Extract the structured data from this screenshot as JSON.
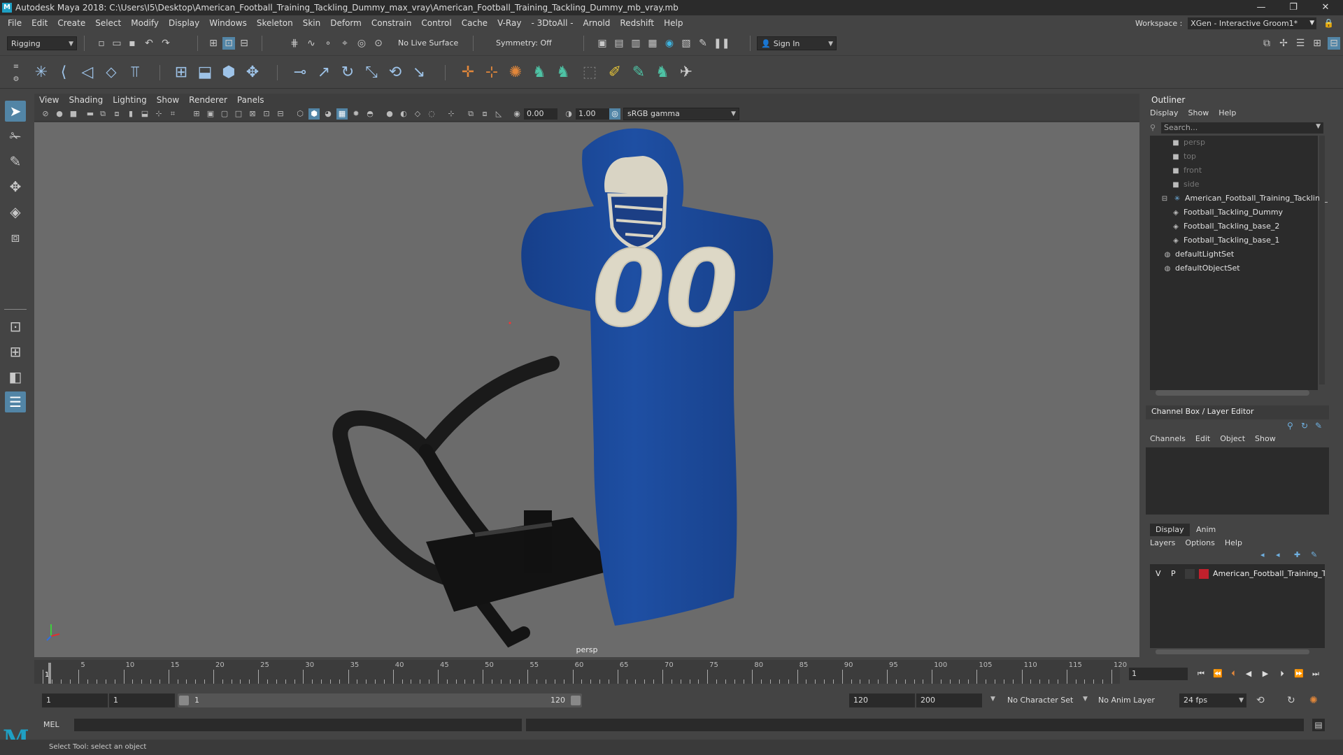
{
  "window": {
    "title": "Autodesk Maya 2018: C:\\Users\\I5\\Desktop\\American_Football_Training_Tackling_Dummy_max_vray\\American_Football_Training_Tackling_Dummy_mb_vray.mb",
    "minimize": "—",
    "restore": "❐",
    "close": "✕"
  },
  "menubar": {
    "items": [
      "File",
      "Edit",
      "Create",
      "Select",
      "Modify",
      "Display",
      "Windows",
      "Skeleton",
      "Skin",
      "Deform",
      "Constrain",
      "Control",
      "Cache",
      "V-Ray",
      "- 3DtoAll -",
      "Arnold",
      "Redshift",
      "Help"
    ],
    "workspace_label": "Workspace :",
    "workspace_value": "XGen - Interactive Groom1*"
  },
  "statusline": {
    "mode": "Rigging",
    "live_surface": "No Live Surface",
    "symmetry": "Symmetry: Off",
    "sign_in": "Sign In"
  },
  "viewport": {
    "menus": [
      "View",
      "Shading",
      "Lighting",
      "Show",
      "Renderer",
      "Panels"
    ],
    "exposure": "0.00",
    "gamma": "1.00",
    "color_space": "sRGB gamma",
    "camera_label": "persp",
    "jersey_number": "00"
  },
  "outliner": {
    "title": "Outliner",
    "menus": [
      "Display",
      "Show",
      "Help"
    ],
    "search_placeholder": "Search...",
    "items": [
      {
        "label": "persp",
        "dim": true
      },
      {
        "label": "top",
        "dim": true
      },
      {
        "label": "front",
        "dim": true
      },
      {
        "label": "side",
        "dim": true
      },
      {
        "label": "American_Football_Training_Tackling_",
        "dim": false
      },
      {
        "label": "Football_Tackling_Dummy",
        "dim": false
      },
      {
        "label": "Football_Tackling_base_2",
        "dim": false
      },
      {
        "label": "Football_Tackling_base_1",
        "dim": false
      },
      {
        "label": "defaultLightSet",
        "dim": false
      },
      {
        "label": "defaultObjectSet",
        "dim": false
      }
    ]
  },
  "channelbox": {
    "title": "Channel Box / Layer Editor",
    "menus": [
      "Channels",
      "Edit",
      "Object",
      "Show"
    ]
  },
  "layereditor": {
    "tabs": [
      "Display",
      "Anim"
    ],
    "menus": [
      "Layers",
      "Options",
      "Help"
    ],
    "layer": {
      "v": "V",
      "p": "P",
      "name": "American_Football_Training_Ta",
      "color": "#c0202c"
    }
  },
  "timeline": {
    "labels": [
      "1",
      "5",
      "10",
      "15",
      "20",
      "25",
      "30",
      "35",
      "40",
      "45",
      "50",
      "55",
      "60",
      "65",
      "70",
      "75",
      "80",
      "85",
      "90",
      "95",
      "100",
      "105",
      "110",
      "115",
      "120"
    ],
    "current_frame": "1"
  },
  "range": {
    "start": "1",
    "playback_start": "1",
    "slider_start": "1",
    "slider_end": "120",
    "playback_end": "120",
    "end": "200",
    "character_set": "No Character Set",
    "anim_layer": "No Anim Layer",
    "fps": "24 fps"
  },
  "command": {
    "lang": "MEL"
  },
  "status": {
    "help_text": "Select Tool: select an object"
  },
  "colors": {
    "dummy_blue": "#1c4a9c",
    "viewport_bg": "#6b6b6b",
    "accent": "#5285a6"
  }
}
